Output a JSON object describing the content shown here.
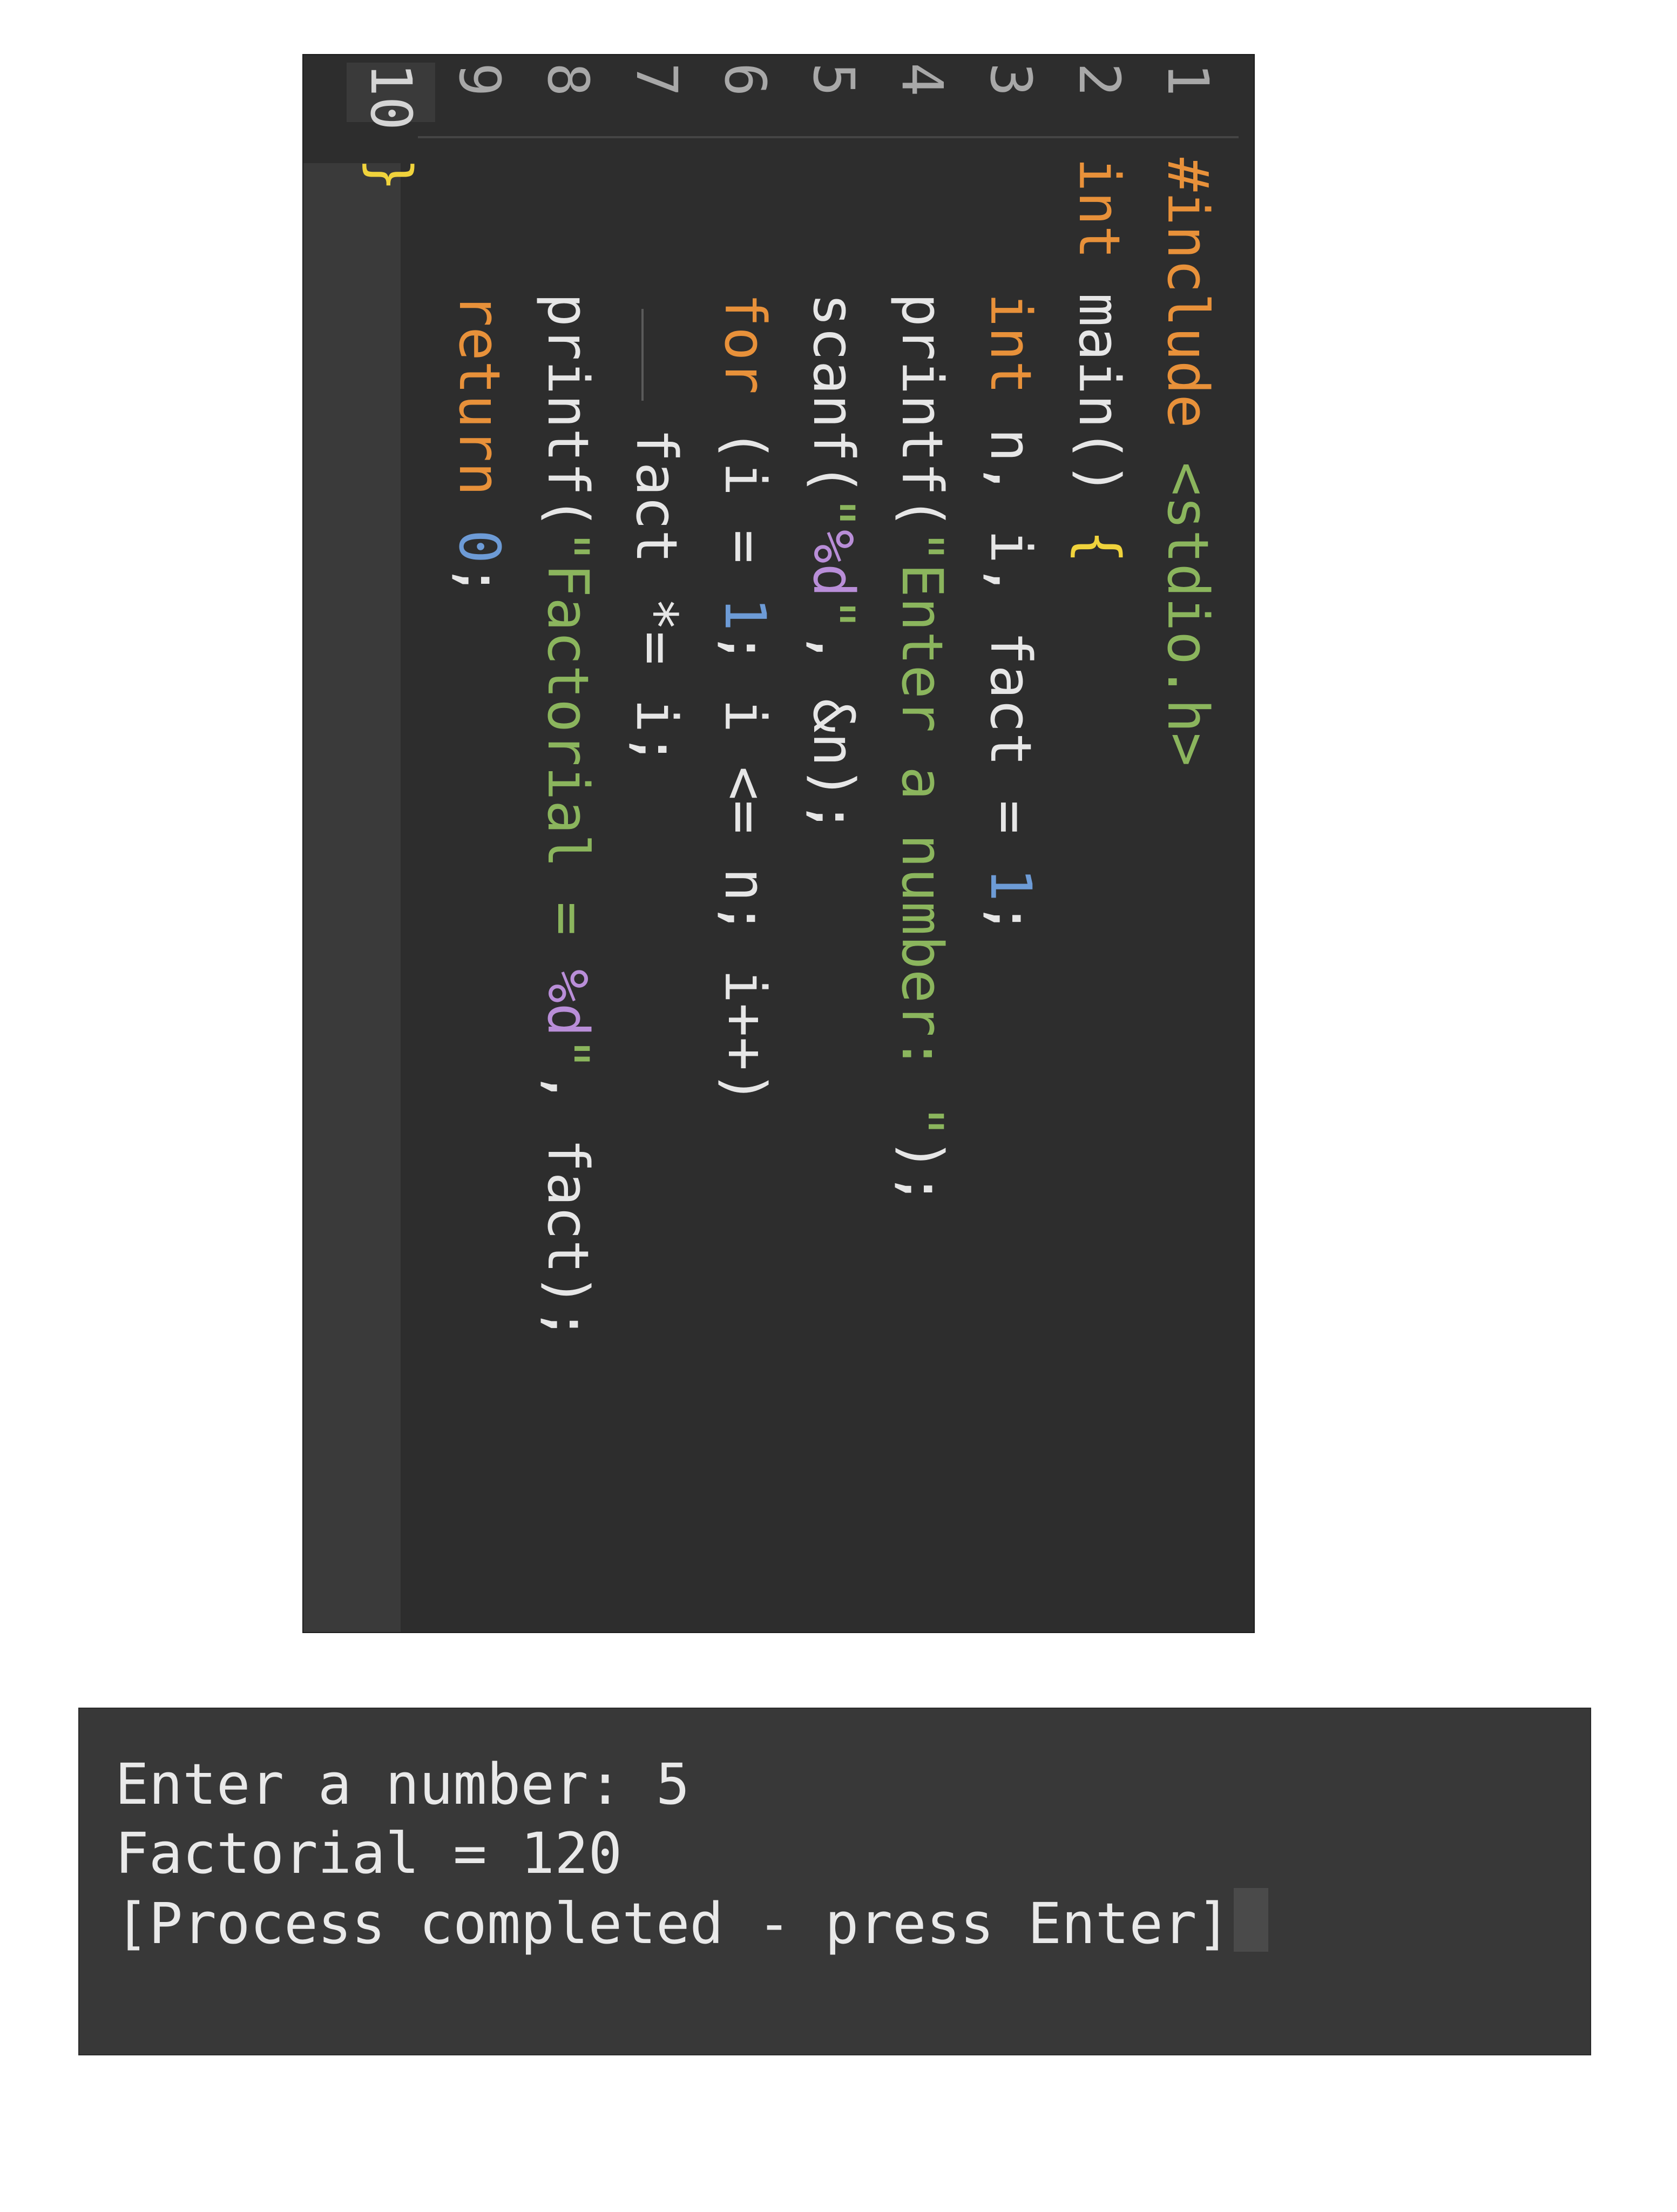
{
  "editor": {
    "line_numbers": [
      "1",
      "2",
      "3",
      "4",
      "5",
      "6",
      "7",
      "8",
      "9",
      "10"
    ],
    "active_line": 10,
    "lines": [
      [
        {
          "t": "#include ",
          "c": "kw"
        },
        {
          "t": "<stdio.h>",
          "c": "str"
        }
      ],
      [
        {
          "t": "int ",
          "c": "kw"
        },
        {
          "t": "main() ",
          "c": "plain"
        },
        {
          "t": "{",
          "c": "brace"
        }
      ],
      [
        {
          "t": "    int ",
          "c": "kw"
        },
        {
          "t": "n, i, fact = ",
          "c": "plain"
        },
        {
          "t": "1",
          "c": "num"
        },
        {
          "t": ";",
          "c": "plain"
        }
      ],
      [
        {
          "t": "    printf(",
          "c": "plain"
        },
        {
          "t": "\"Enter a number: \"",
          "c": "str"
        },
        {
          "t": ");",
          "c": "plain"
        }
      ],
      [
        {
          "t": "    scanf(",
          "c": "plain"
        },
        {
          "t": "\"",
          "c": "str"
        },
        {
          "t": "%d",
          "c": "fmt"
        },
        {
          "t": "\"",
          "c": "str"
        },
        {
          "t": ", &n);",
          "c": "plain"
        }
      ],
      [
        {
          "t": "    for ",
          "c": "kw"
        },
        {
          "t": "(i = ",
          "c": "plain"
        },
        {
          "t": "1",
          "c": "num"
        },
        {
          "t": "; i <= n; i++)",
          "c": "plain"
        }
      ],
      [
        {
          "t": "        fact *= i;",
          "c": "plain"
        }
      ],
      [
        {
          "t": "    printf(",
          "c": "plain"
        },
        {
          "t": "\"Factorial = ",
          "c": "str"
        },
        {
          "t": "%d",
          "c": "fmt"
        },
        {
          "t": "\"",
          "c": "str"
        },
        {
          "t": ", fact);",
          "c": "plain"
        }
      ],
      [
        {
          "t": "    return ",
          "c": "kw"
        },
        {
          "t": "0",
          "c": "num"
        },
        {
          "t": ";",
          "c": "plain"
        }
      ],
      [
        {
          "t": "}",
          "c": "brace"
        }
      ]
    ]
  },
  "terminal": {
    "lines": [
      "Enter a number: 5",
      "Factorial = 120",
      "[Process completed - press Enter]"
    ]
  },
  "colors": {
    "editor_bg": "#2d2d2d",
    "terminal_bg": "#383838",
    "keyword": "#e8913a",
    "string": "#8bb55d",
    "number": "#6d9bd6",
    "format_specifier": "#b98ed8",
    "brace": "#f0d33c"
  }
}
